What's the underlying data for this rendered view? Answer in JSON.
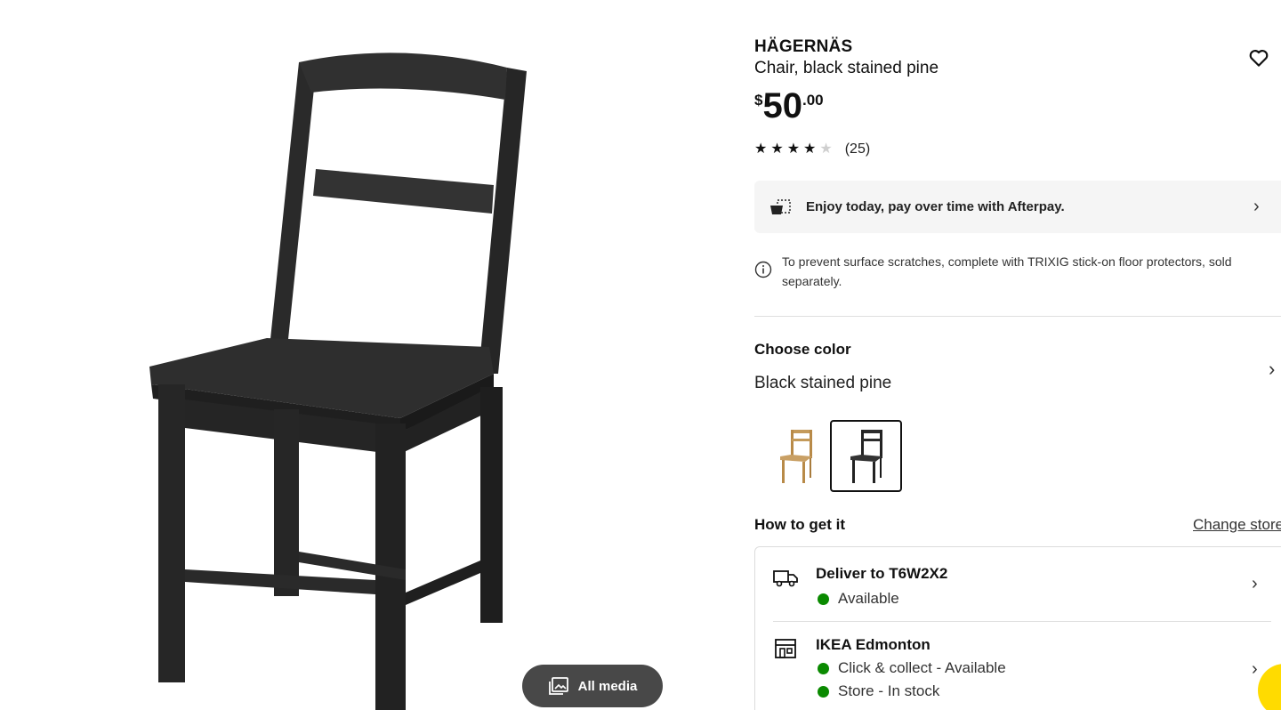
{
  "media": {
    "all_media_label": "All media",
    "image_icon": "image-gallery-icon"
  },
  "product": {
    "name": "HÄGERNÄS",
    "description": "Chair, black stained pine",
    "price_currency": "$",
    "price_int": "50",
    "price_dec": ".00",
    "rating_value": 4.5,
    "rating_max": 5,
    "review_count": "(25)",
    "favorite_icon": "heart-icon"
  },
  "afterpay": {
    "text": "Enjoy today, pay over time with Afterpay.",
    "icon": "afterpay-icon"
  },
  "notice": {
    "text": "To prevent surface scratches, complete with TRIXIG stick-on floor protectors, sold separately.",
    "icon": "info-icon"
  },
  "color": {
    "title": "Choose color",
    "selected": "Black stained pine",
    "swatches": [
      {
        "label": "Pine",
        "color": "#c49a5a",
        "selected": false
      },
      {
        "label": "Black stained pine",
        "color": "#2b2b2b",
        "selected": true
      }
    ]
  },
  "fulfillment": {
    "title": "How to get it",
    "change_store_label": "Change store",
    "delivery": {
      "title": "Deliver to T6W2X2",
      "status": "Available",
      "icon": "truck-icon"
    },
    "store": {
      "title": "IKEA Edmonton",
      "status_1": "Click & collect - Available",
      "status_2": "Store - In stock",
      "icon": "store-icon"
    },
    "status_color": "#0a8a00"
  },
  "colors": {
    "accent": "#ffdb00",
    "button_dark": "#484848",
    "panel_bg": "#f5f5f5"
  }
}
